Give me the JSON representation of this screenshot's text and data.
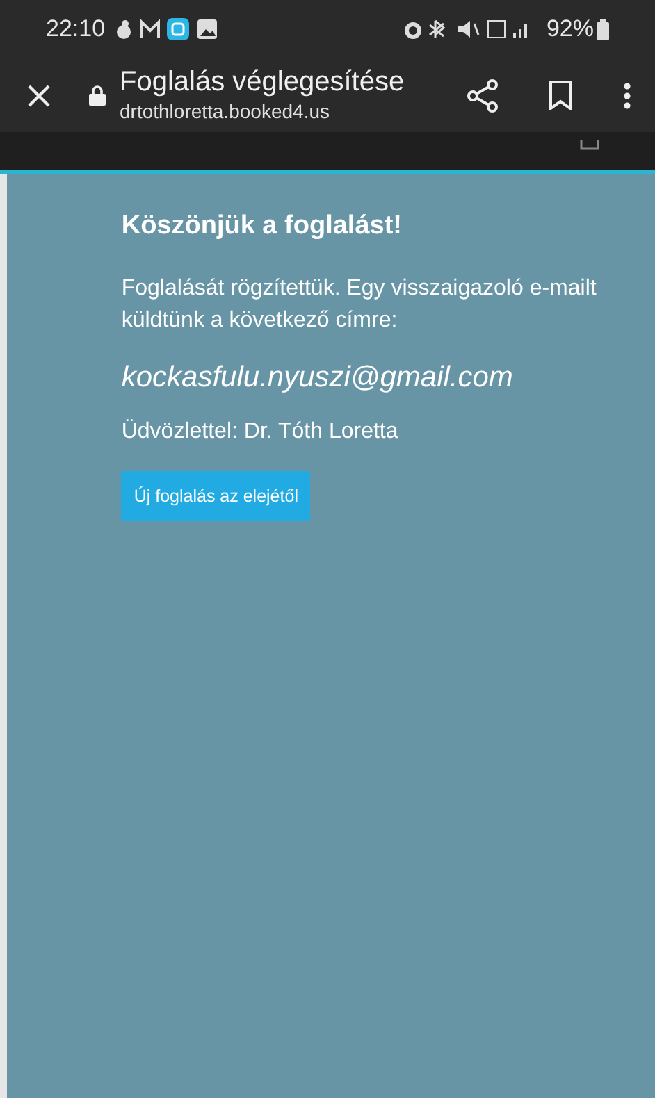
{
  "status_bar": {
    "time": "22:10",
    "battery": "92%"
  },
  "toolbar": {
    "title": "Foglalás véglegesítése",
    "url": "drtothloretta.booked4.us"
  },
  "page": {
    "heading": "Köszönjük a foglalást!",
    "message": "Foglalását rögzítettük. Egy visszaigazoló e-mailt küldtünk a következő címre:",
    "email": "kockasfulu.nyuszi@gmail.com",
    "signature": "Üdvözlettel: Dr. Tóth Loretta",
    "button": "Új foglalás az elejétől"
  }
}
